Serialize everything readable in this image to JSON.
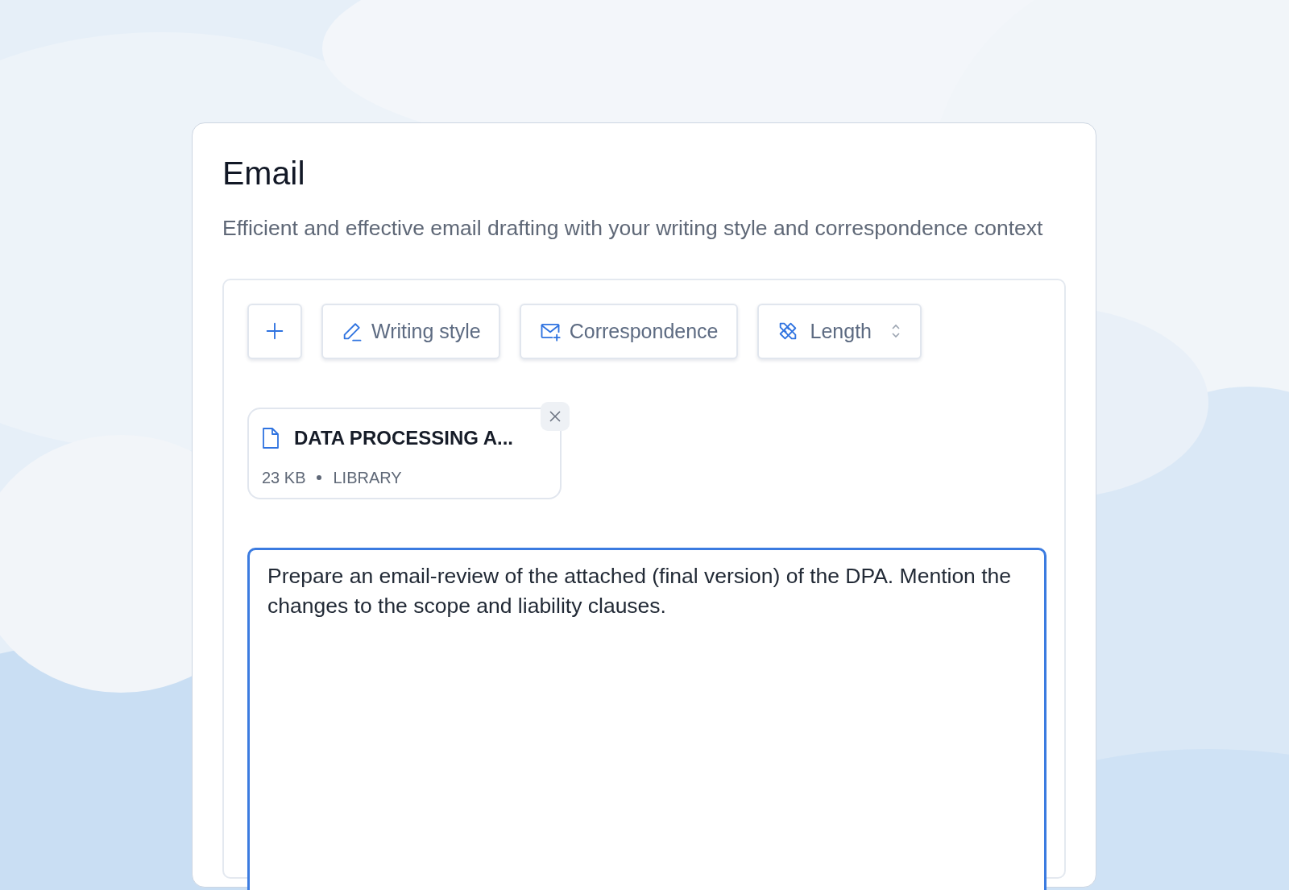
{
  "title": "Email",
  "subtitle": "Efficient and effective email drafting with your writing style and correspondence context",
  "toolbar": [
    {
      "kind": "add"
    },
    {
      "kind": "writing",
      "label": "Writing style"
    },
    {
      "kind": "correspondence",
      "label": "Correspondence"
    },
    {
      "kind": "length",
      "label": "Length"
    }
  ],
  "attachments": [
    {
      "name": "DATA PROCESSING A...",
      "size": "23 KB",
      "source": "LIBRARY"
    }
  ],
  "prompt": {
    "value": "Prepare an email-review of the attached (final version) of the DPA. Mention the changes to the scope and liability clauses."
  }
}
